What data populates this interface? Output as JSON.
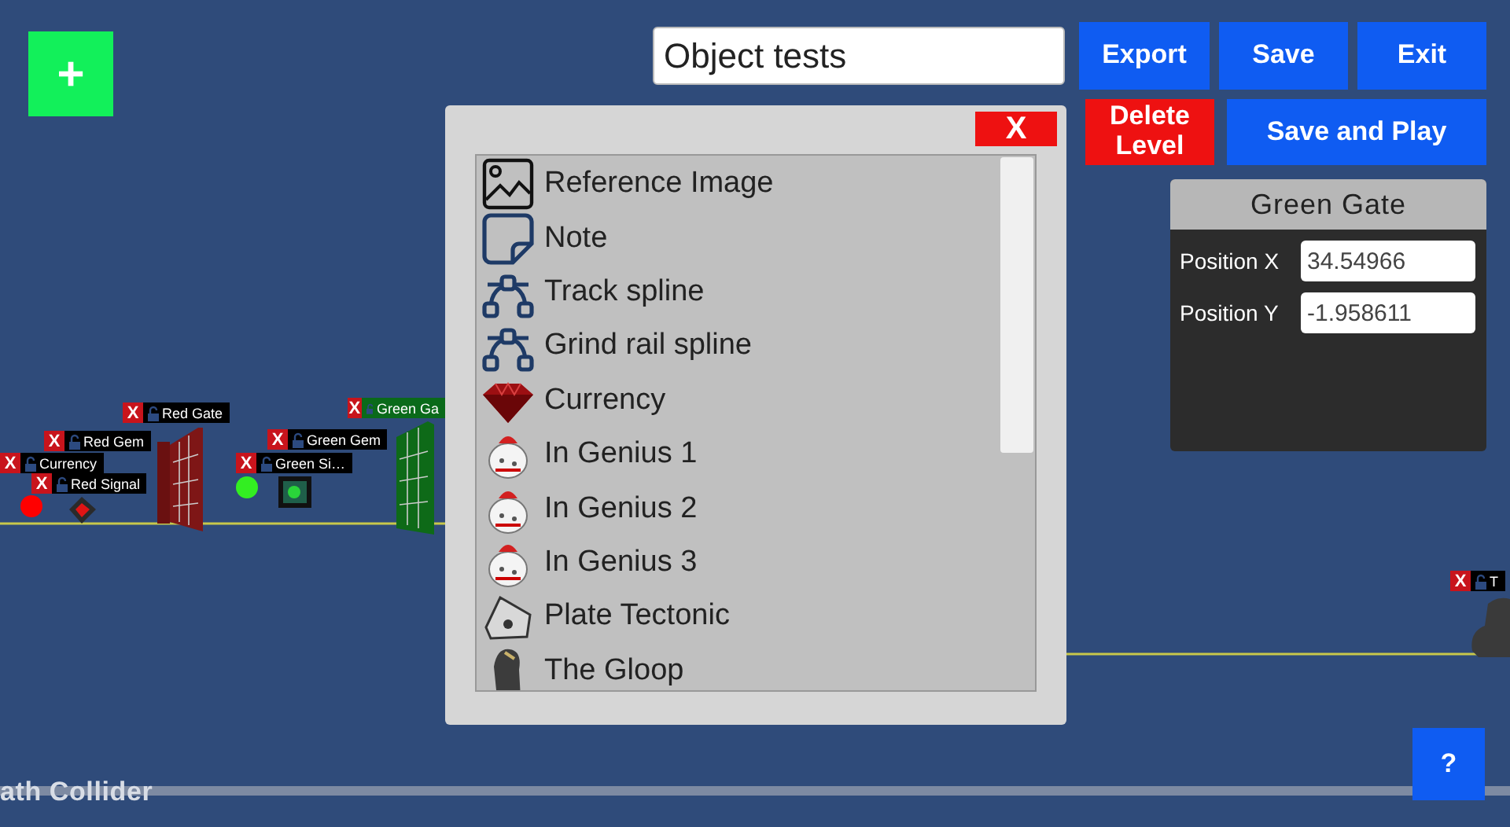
{
  "add_button": {
    "label": "+"
  },
  "level_name": {
    "value": "Object tests"
  },
  "toolbar_buttons": [
    {
      "label": "Export",
      "kind": "primary"
    },
    {
      "label": "Save",
      "kind": "primary"
    },
    {
      "label": "Exit",
      "kind": "primary"
    },
    {
      "label": "Delete Level",
      "kind": "danger"
    },
    {
      "label": "Save and Play",
      "kind": "primary"
    }
  ],
  "inspector": {
    "title": "Green Gate",
    "fields": [
      {
        "label": "Position X",
        "value": "34.54966"
      },
      {
        "label": "Position Y",
        "value": "-1.958611"
      }
    ]
  },
  "object_picker": {
    "close_label": "X",
    "items": [
      {
        "label": "Reference Image"
      },
      {
        "label": "Note"
      },
      {
        "label": "Track spline"
      },
      {
        "label": "Grind rail spline"
      },
      {
        "label": "Currency"
      },
      {
        "label": "In Genius 1"
      },
      {
        "label": "In Genius 2"
      },
      {
        "label": "In Genius 3"
      },
      {
        "label": "Plate Tectonic"
      },
      {
        "label": "The Gloop"
      }
    ]
  },
  "scene_tags": [
    {
      "delete_label": "X",
      "label": "Red Gate",
      "selected": false
    },
    {
      "delete_label": "X",
      "label": "Green Ga",
      "selected": true
    },
    {
      "delete_label": "X",
      "label": "Red Gem",
      "selected": false
    },
    {
      "delete_label": "X",
      "label": "Green Gem",
      "selected": false
    },
    {
      "delete_label": "X",
      "label": "Currency",
      "selected": false
    },
    {
      "delete_label": "X",
      "label": "Green Si…",
      "selected": false
    },
    {
      "delete_label": "X",
      "label": "Red Signal",
      "selected": false
    },
    {
      "delete_label": "X",
      "label": "T",
      "selected": false
    }
  ],
  "signals": [
    {
      "color": "#ff0000"
    },
    {
      "color": "#33ee22"
    }
  ],
  "path_label": "ath Collider",
  "help_button": {
    "label": "?"
  }
}
